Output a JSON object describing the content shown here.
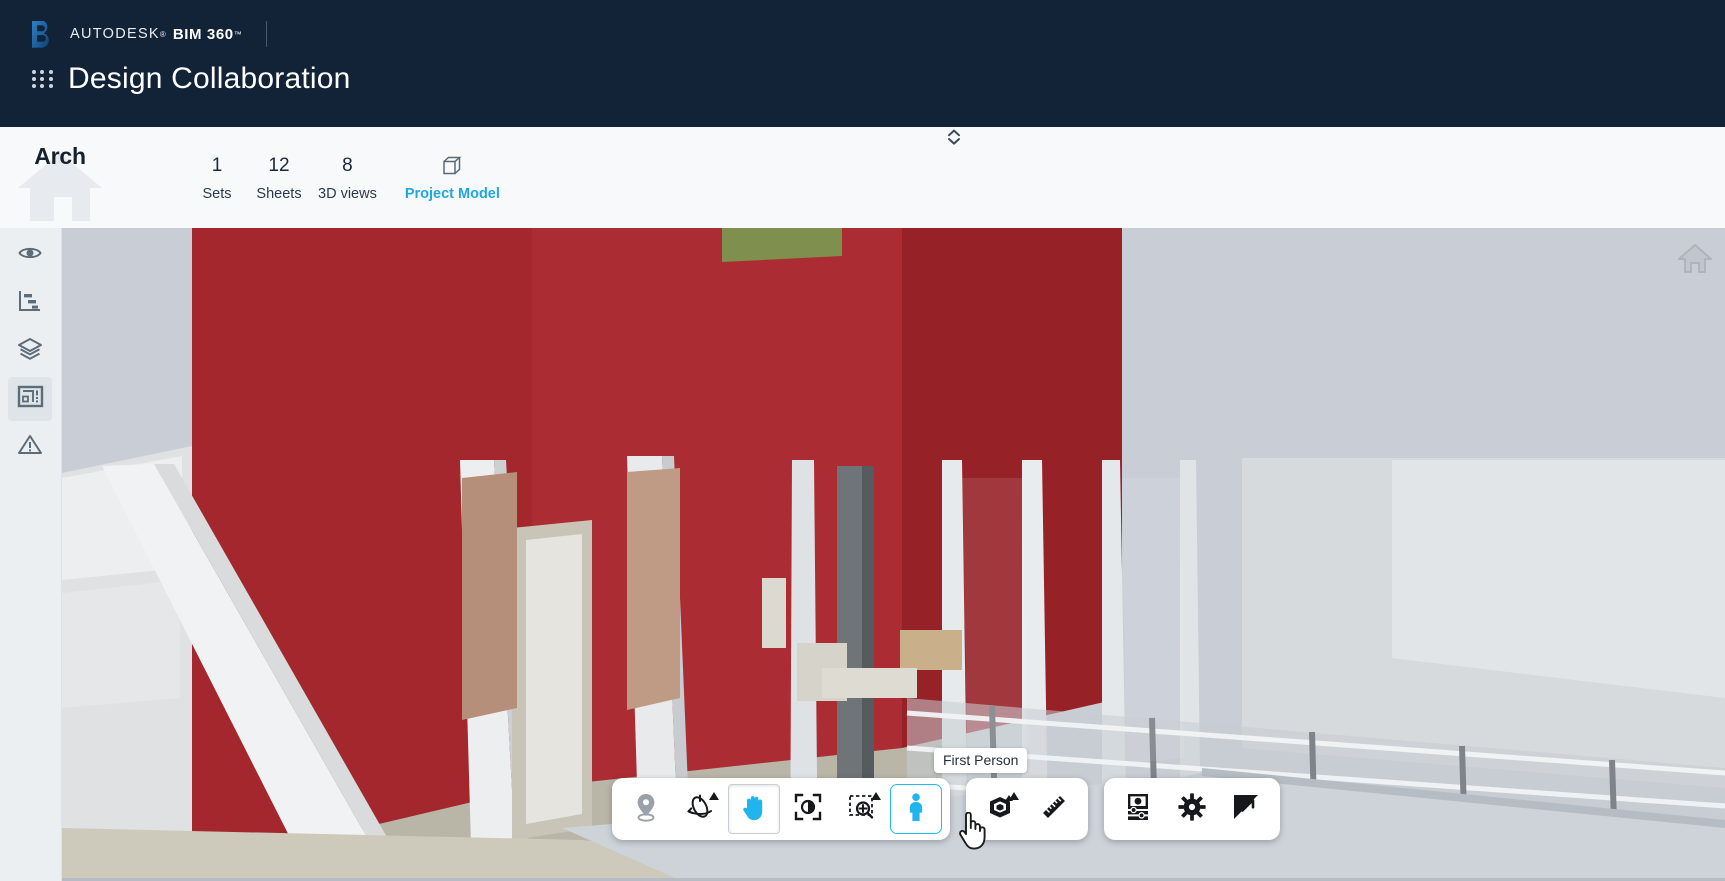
{
  "header": {
    "brand_autodesk": "AUTODESK",
    "brand_autodesk_sup": "®",
    "brand_product": "BIM 360",
    "brand_product_sup": "™",
    "app_title": "Design Collaboration",
    "apps_grid_icon": "apps-grid-icon",
    "logo_icon": "autodesk-b-logo-icon",
    "background_color": "#122338"
  },
  "subheader": {
    "team_name": "Arch",
    "team_icon": "home-house-icon",
    "background_color": "#f7f9fb",
    "accent_color": "#1fa8e0",
    "tabs": [
      {
        "count": "1",
        "label": "Sets",
        "icon": "",
        "active": false
      },
      {
        "count": "12",
        "label": "Sheets",
        "icon": "",
        "active": false
      },
      {
        "count": "8",
        "label": "3D views",
        "icon": "",
        "active": false
      },
      {
        "count": "",
        "label": "Project Model",
        "icon": "cube-icon",
        "active": true
      }
    ],
    "collapse_handle_icon": "chevron-up-down-icon"
  },
  "left_rail": {
    "items": [
      {
        "name": "visibility",
        "icon": "eye-icon",
        "selected": false
      },
      {
        "name": "section",
        "icon": "section-chart-icon",
        "selected": false
      },
      {
        "name": "layers",
        "icon": "layers-stack-icon",
        "selected": false
      },
      {
        "name": "model-browser",
        "icon": "model-browser-icon",
        "selected": true
      },
      {
        "name": "issues",
        "icon": "warning-triangle-icon",
        "selected": false
      }
    ]
  },
  "viewer": {
    "home_icon": "view-home-icon",
    "tooltip": "First Person",
    "cursor_icon": "pointer-hand-cursor-icon"
  },
  "toolbar": {
    "groups": [
      {
        "name": "navigation-group",
        "buttons": [
          {
            "name": "section-pin-button",
            "icon": "location-pin-icon",
            "label": "Section Pin",
            "state": "disabled",
            "caret": false
          },
          {
            "name": "orbit-button",
            "icon": "orbit-icon",
            "label": "Orbit",
            "state": "normal",
            "caret": true
          },
          {
            "name": "pan-button",
            "icon": "hand-pan-icon",
            "label": "Pan",
            "state": "pressed",
            "caret": false
          },
          {
            "name": "fit-to-view-button",
            "icon": "fit-to-view-icon",
            "label": "Fit to View",
            "state": "normal",
            "caret": false
          },
          {
            "name": "zoom-window-button",
            "icon": "zoom-window-icon",
            "label": "Zoom",
            "state": "normal",
            "caret": true
          },
          {
            "name": "first-person-button",
            "icon": "first-person-icon",
            "label": "First Person",
            "state": "active",
            "caret": false
          }
        ]
      },
      {
        "name": "tools-group",
        "buttons": [
          {
            "name": "section-analysis-button",
            "icon": "section-box-icon",
            "label": "Section Analysis",
            "state": "normal",
            "caret": true
          },
          {
            "name": "measure-button",
            "icon": "ruler-icon",
            "label": "Measure",
            "state": "normal",
            "caret": false
          }
        ]
      },
      {
        "name": "display-group",
        "buttons": [
          {
            "name": "explode-button",
            "icon": "explode-slider-icon",
            "label": "Explode",
            "state": "normal",
            "caret": false
          },
          {
            "name": "settings-button",
            "icon": "gear-icon",
            "label": "Settings",
            "state": "normal",
            "caret": false
          },
          {
            "name": "fullscreen-button",
            "icon": "fullscreen-icon",
            "label": "Full Screen",
            "state": "normal",
            "caret": false
          }
        ]
      }
    ]
  },
  "colors": {
    "nav_background": "#122338",
    "accent_cyan": "#1fa8e0",
    "active_blue": "#1fbcee",
    "panel_background": "#f7f9fb",
    "rail_background": "#eceff2",
    "wall_red": "#a6292f",
    "floor_gray": "#c3c9d2"
  }
}
